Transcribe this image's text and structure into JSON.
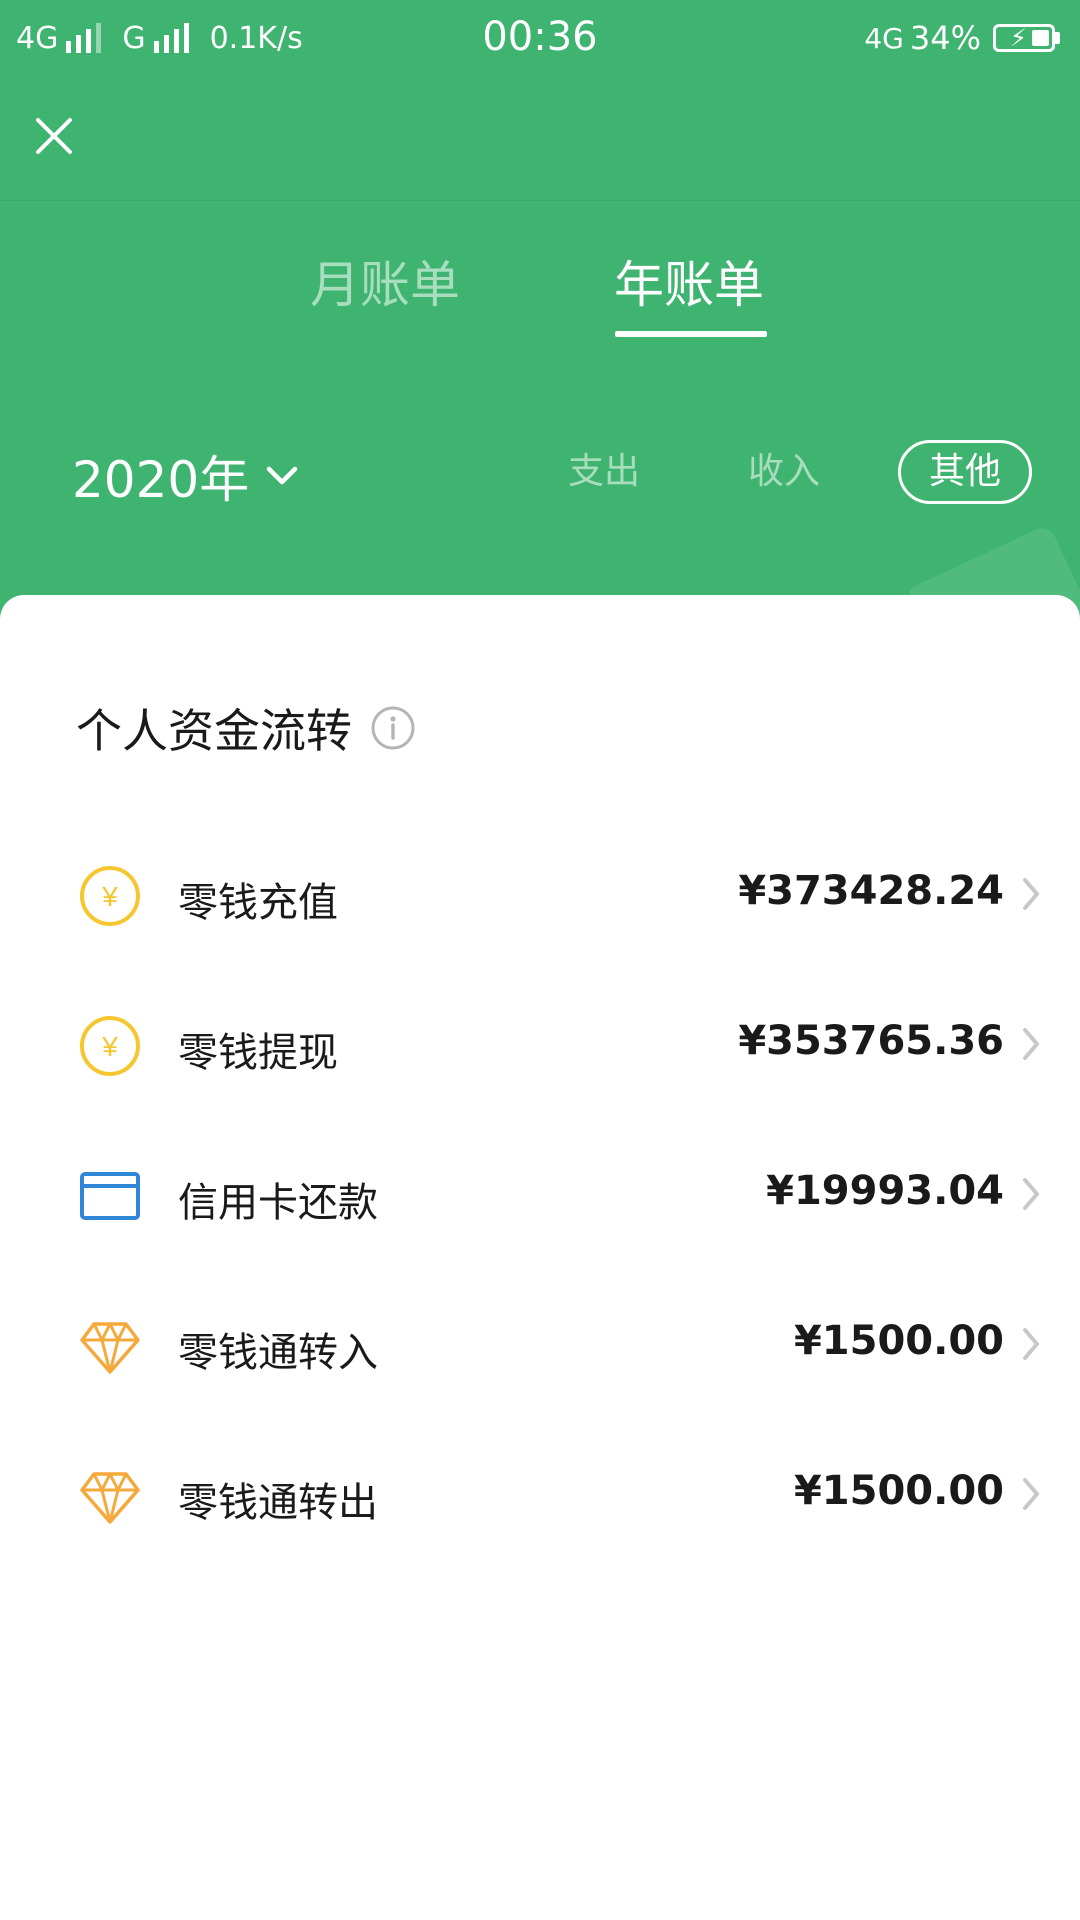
{
  "status_bar": {
    "signal1": "4G",
    "signal2": "G",
    "speed": "0.1K/s",
    "time": "00:36",
    "network": "4G",
    "battery": "34%",
    "battery_level": 0.34
  },
  "header": {
    "close_icon": "close-icon"
  },
  "tabs": {
    "month": "月账单",
    "year": "年账单",
    "active": "year"
  },
  "filters": {
    "year": "2020年",
    "expense": "支出",
    "income": "收入",
    "other": "其他",
    "active": "other"
  },
  "section": {
    "title": "个人资金流转",
    "info_icon": "info-icon"
  },
  "rows": [
    {
      "label": "零钱充值",
      "amount": "¥373428.24",
      "icon": "coin-icon"
    },
    {
      "label": "零钱提现",
      "amount": "¥353765.36",
      "icon": "coin-icon"
    },
    {
      "label": "信用卡还款",
      "amount": "¥19993.04",
      "icon": "card-icon"
    },
    {
      "label": "零钱通转入",
      "amount": "¥1500.00",
      "icon": "diamond-icon"
    },
    {
      "label": "零钱通转出",
      "amount": "¥1500.00",
      "icon": "diamond-icon"
    }
  ],
  "colors": {
    "brand_green": "#3eb470",
    "coin_yellow": "#f6c631",
    "card_blue": "#2f86d6",
    "diamond_orange": "#f5a93a"
  }
}
